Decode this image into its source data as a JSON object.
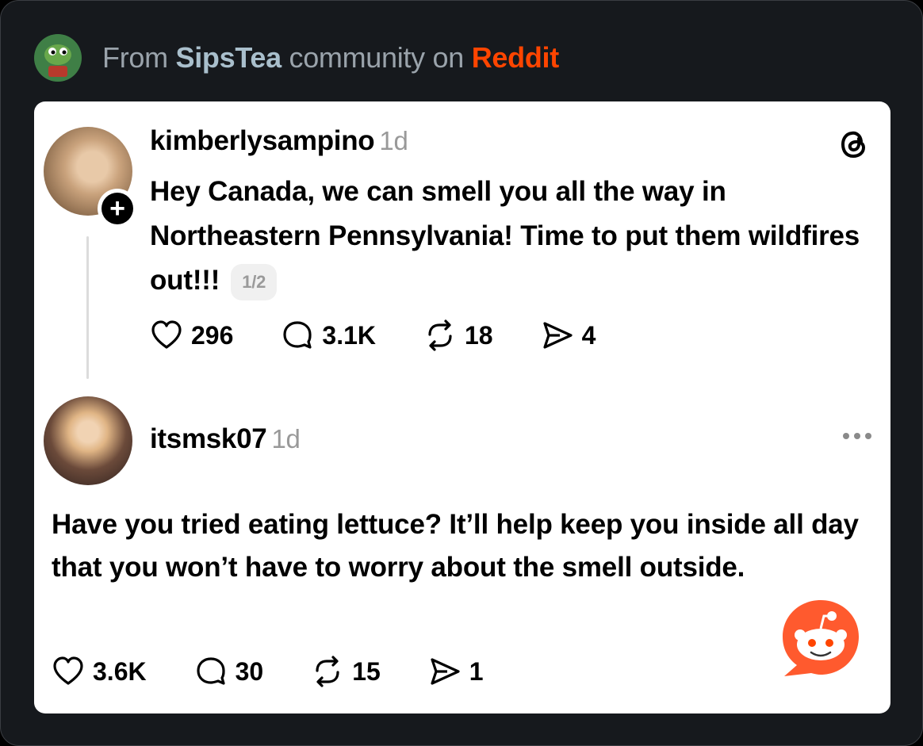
{
  "header": {
    "from": "From",
    "community": "SipsTea",
    "mid": "community on",
    "platform": "Reddit"
  },
  "post1": {
    "username": "kimberlysampino",
    "age": "1d",
    "text": "Hey Canada, we can smell you all the way in Northeastern Pennsylvania! Time to put them wildfires out!!!",
    "pager": "1/2",
    "likes": "296",
    "replies": "3.1K",
    "reposts": "18",
    "shares": "4"
  },
  "post2": {
    "username": "itsmsk07",
    "age": "1d",
    "text": "Have you tried eating lettuce? It’ll help keep you inside all day that you won’t have to worry about the smell outside.",
    "likes": "3.6K",
    "replies": "30",
    "reposts": "15",
    "shares": "1"
  },
  "icons": {
    "like": "heart-icon",
    "reply": "comment-icon",
    "repost": "repost-icon",
    "share": "send-icon",
    "more": "more-icon",
    "threads": "threads-logo-icon",
    "reddit": "reddit-snoo-icon"
  },
  "colors": {
    "reddit_orange": "#ff4500",
    "community_name": "#a9bfcc",
    "background": "#16191d"
  }
}
